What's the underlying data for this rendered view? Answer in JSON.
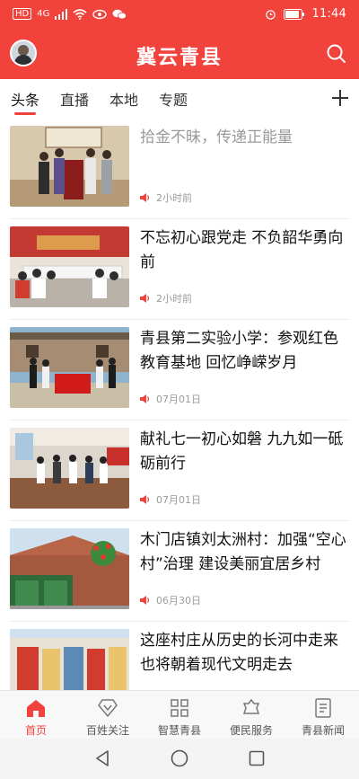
{
  "status_bar": {
    "network_label": "HD",
    "signal_label": "4G",
    "time": "11:44"
  },
  "header": {
    "title": "冀云青县",
    "avatar_icon": "avatar",
    "search_icon": "search-icon"
  },
  "tabs": [
    {
      "label": "头条",
      "active": true
    },
    {
      "label": "直播",
      "active": false
    },
    {
      "label": "本地",
      "active": false
    },
    {
      "label": "专题",
      "active": false
    }
  ],
  "tab_add_icon": "plus-icon",
  "feed": [
    {
      "title": "拾金不昧，传递正能量",
      "meta": "2小时前",
      "read": true
    },
    {
      "title": "不忘初心跟党走 不负韶华勇向前",
      "meta": "2小时前",
      "read": false
    },
    {
      "title": "青县第二实验小学：参观红色教育基地 回忆峥嵘岁月",
      "meta": "07月01日",
      "read": false
    },
    {
      "title": "献礼七一初心如磐 九九如一砥砺前行",
      "meta": "07月01日",
      "read": false
    },
    {
      "title": "木门店镇刘太洲村：加强“空心村”治理 建设美丽宜居乡村",
      "meta": "06月30日",
      "read": false
    },
    {
      "title": "这座村庄从历史的长河中走来也将朝着现代文明走去",
      "meta": "",
      "read": false
    }
  ],
  "bottom_nav": [
    {
      "label": "首页",
      "icon": "home-icon",
      "active": true
    },
    {
      "label": "百姓关注",
      "icon": "diamond-icon",
      "active": false
    },
    {
      "label": "智慧青县",
      "icon": "grid-icon",
      "active": false
    },
    {
      "label": "便民服务",
      "icon": "service-icon",
      "active": false
    },
    {
      "label": "青县新闻",
      "icon": "newspaper-icon",
      "active": false
    }
  ],
  "colors": {
    "brand_red": "#f2423c",
    "text_dark": "#111111",
    "text_muted": "#9b9b9b"
  }
}
